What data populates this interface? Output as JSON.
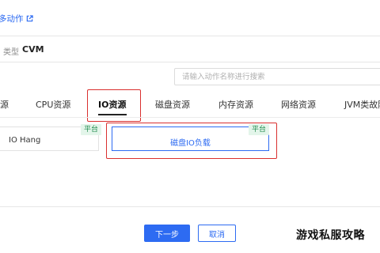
{
  "header": {
    "link_text": "多动作",
    "link_icon": "external-link-icon"
  },
  "resource": {
    "type_label": "类型",
    "type_value": "CVM"
  },
  "search": {
    "placeholder": "请输入动作名称进行搜索"
  },
  "tabs": [
    {
      "label": "源"
    },
    {
      "label": "CPU资源"
    },
    {
      "label": "IO资源",
      "active": true
    },
    {
      "label": "磁盘资源"
    },
    {
      "label": "内存资源"
    },
    {
      "label": "网络资源"
    },
    {
      "label": "JVM类故障"
    }
  ],
  "actions": [
    {
      "label": "IO Hang",
      "badge": "平台",
      "selected": false
    },
    {
      "label": "磁盘IO负载",
      "badge": "平台",
      "selected": true
    }
  ],
  "footer": {
    "next_label": "下一步",
    "cancel_label": "取消"
  },
  "watermark": "游戏私服攻略",
  "colors": {
    "primary": "#2d6bf2",
    "highlight_red": "#d9302f",
    "badge_green": "#1f8a4c",
    "badge_bg": "#e3f5ea"
  }
}
